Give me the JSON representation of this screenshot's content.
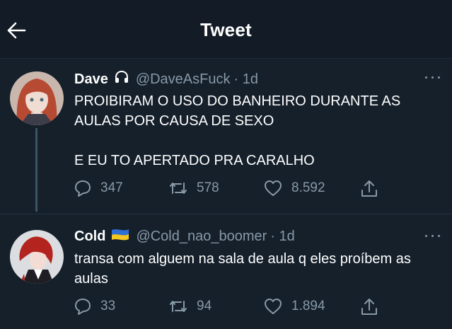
{
  "header": {
    "title": "Tweet",
    "back_icon": "arrow-left-icon"
  },
  "colors": {
    "background": "#15202b",
    "text": "#ffffff",
    "muted": "#8899a6",
    "thread_line": "#3d5466"
  },
  "tweets": [
    {
      "name": "Dave",
      "badge_icon": "headphones-icon",
      "handle": "@DaveAsFuck",
      "time": "· 1d",
      "body": [
        "PROIBIRAM O USO DO BANHEIRO DURANTE AS AULAS POR CAUSA DE SEXO",
        "E EU TO APERTADO PRA CARALHO"
      ],
      "replies": "347",
      "retweets": "578",
      "likes": "8.592"
    },
    {
      "name": "Cold",
      "badge_icon": "ukraine-flag-icon",
      "handle": "@Cold_nao_boomer",
      "time": "· 1d",
      "body": [
        "transa com alguem na sala de aula q eles proíbem as aulas"
      ],
      "replies": "33",
      "retweets": "94",
      "likes": "1.894"
    }
  ]
}
